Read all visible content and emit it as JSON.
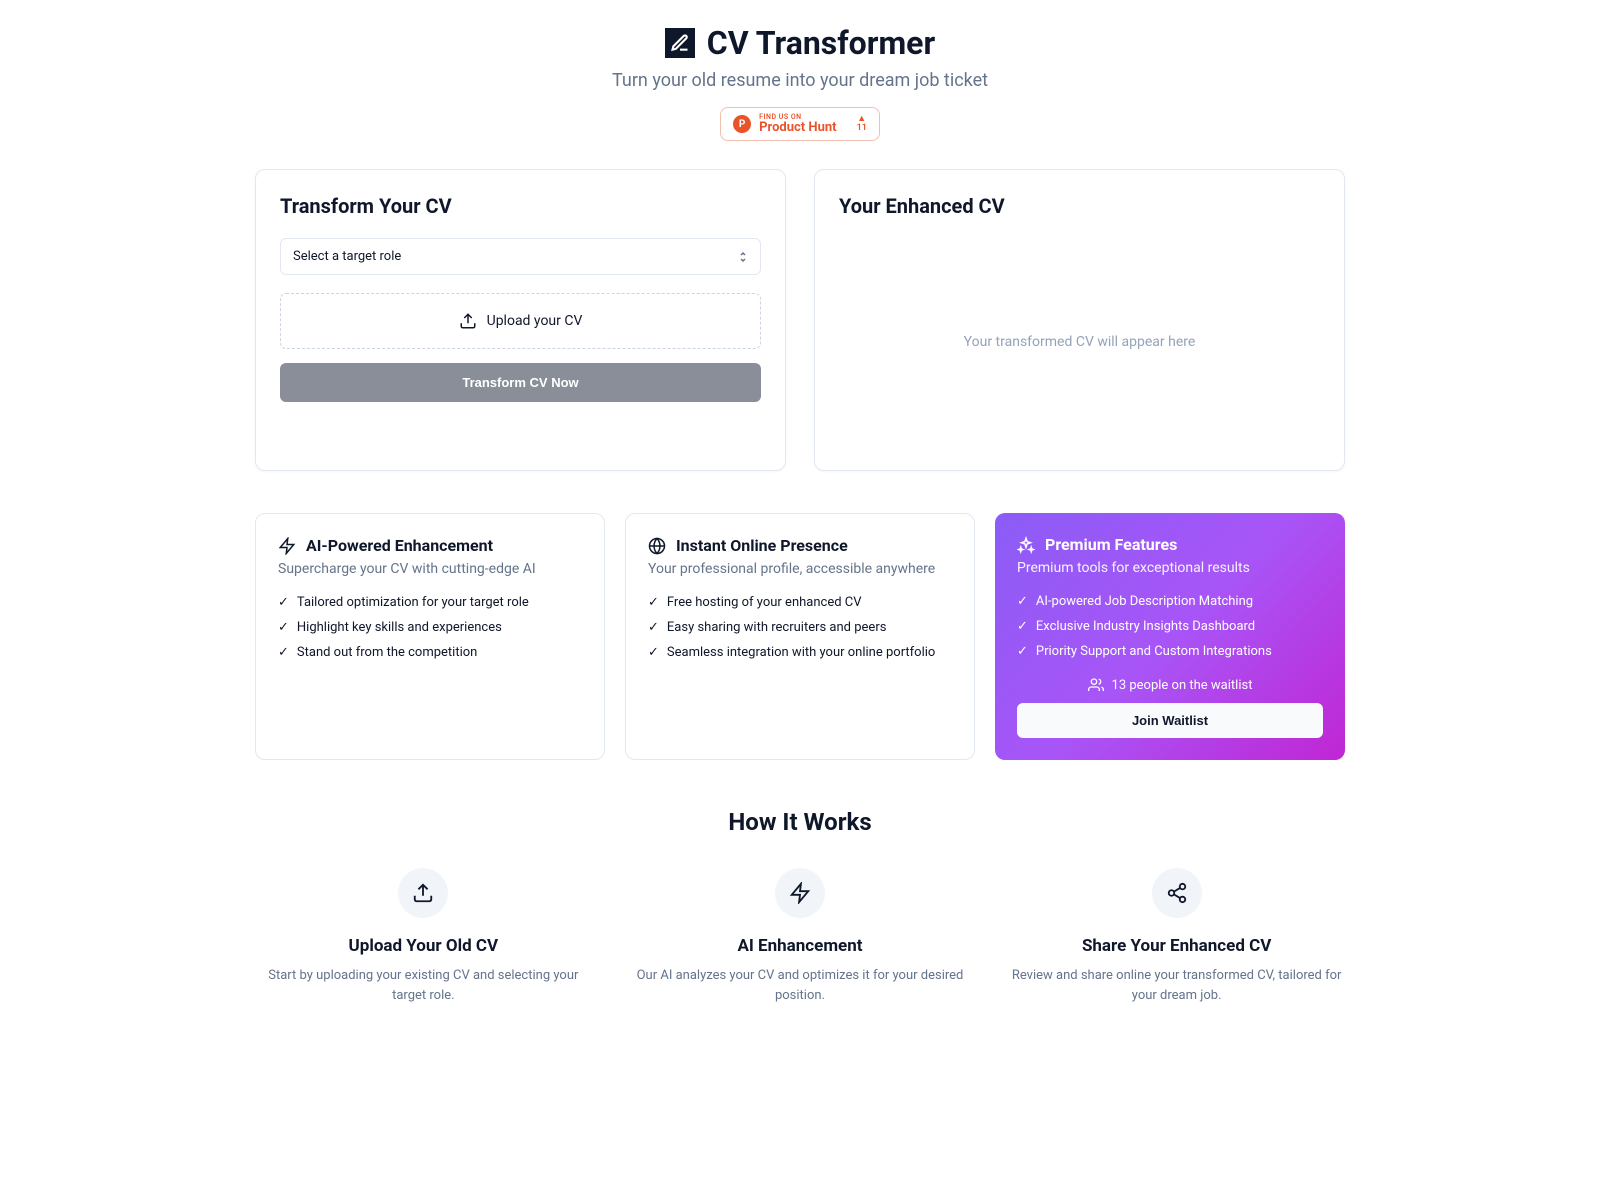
{
  "header": {
    "title": "CV Transformer",
    "subtitle": "Turn your old resume into your dream job ticket",
    "ph_findus": "FIND US ON",
    "ph_name": "Product Hunt",
    "ph_upvotes": "11"
  },
  "transform": {
    "title": "Transform Your CV",
    "select_placeholder": "Select a target role",
    "upload_label": "Upload your CV",
    "button_label": "Transform CV Now"
  },
  "output": {
    "title": "Your Enhanced CV",
    "placeholder": "Your transformed CV will appear here"
  },
  "features": [
    {
      "title": "AI-Powered Enhancement",
      "subtitle": "Supercharge your CV with cutting-edge AI",
      "items": [
        "Tailored optimization for your target role",
        "Highlight key skills and experiences",
        "Stand out from the competition"
      ]
    },
    {
      "title": "Instant Online Presence",
      "subtitle": "Your professional profile, accessible anywhere",
      "items": [
        "Free hosting of your enhanced CV",
        "Easy sharing with recruiters and peers",
        "Seamless integration with your online portfolio"
      ]
    },
    {
      "title": "Premium Features",
      "subtitle": "Premium tools for exceptional results",
      "items": [
        "AI-powered Job Description Matching",
        "Exclusive Industry Insights Dashboard",
        "Priority Support and Custom Integrations"
      ],
      "waitlist_text": "13 people on the waitlist",
      "waitlist_button": "Join Waitlist"
    }
  ],
  "how": {
    "title": "How It Works",
    "steps": [
      {
        "title": "Upload Your Old CV",
        "desc": "Start by uploading your existing CV and selecting your target role."
      },
      {
        "title": "AI Enhancement",
        "desc": "Our AI analyzes your CV and optimizes it for your desired position."
      },
      {
        "title": "Share Your Enhanced CV",
        "desc": "Review and share online your transformed CV, tailored for your dream job."
      }
    ]
  }
}
